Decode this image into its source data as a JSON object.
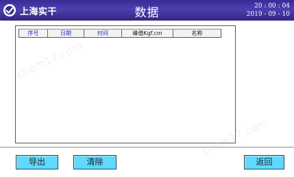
{
  "header": {
    "brand": "上海实干",
    "title": "数据",
    "time": "20 : 00 : 04",
    "date": "2019 - 09 - 10",
    "logo_icon": "company-logo-icon"
  },
  "table": {
    "columns": [
      {
        "label": "序号",
        "color": "#2233bb"
      },
      {
        "label": "日期",
        "color": "#2233bb"
      },
      {
        "label": "时间",
        "color": "#2233bb"
      },
      {
        "label": "峰值Kgf.cm",
        "color": "#111111"
      },
      {
        "label": "名称",
        "color": "#111111"
      }
    ],
    "rows": []
  },
  "buttons": {
    "export": "导出",
    "clear": "清除",
    "back": "返回"
  },
  "watermark": "chem17.com",
  "colors": {
    "header_bg": "#3a2c95",
    "button_bg": "#5fd9ff"
  }
}
